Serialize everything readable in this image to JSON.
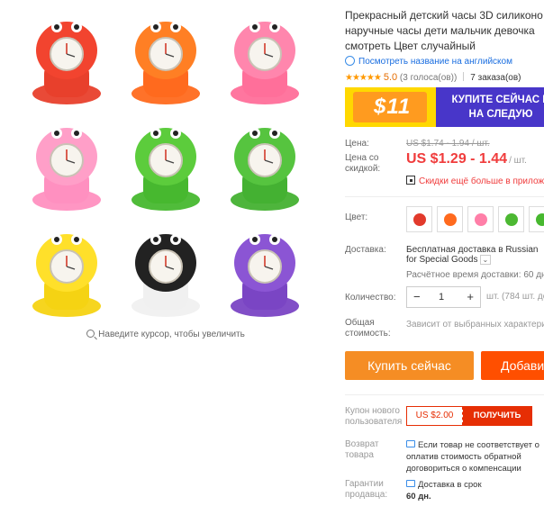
{
  "gallery": {
    "zoom_hint": "Наведите курсор, чтобы увеличить",
    "thumbnails": [
      {
        "name": "crab",
        "strap": "#e8402c",
        "face": "#f2442f"
      },
      {
        "name": "clownfish",
        "strap": "#ff6a1e",
        "face": "#ff7f24"
      },
      {
        "name": "penguin",
        "strap": "#ff6f9a",
        "face": "#ff86ad"
      },
      {
        "name": "butterfly",
        "strap": "#ff90c0",
        "face": "#ff9fc8"
      },
      {
        "name": "crocodile",
        "strap": "#47b82f",
        "face": "#5ccc3c"
      },
      {
        "name": "frog",
        "strap": "#44b132",
        "face": "#56c43f"
      },
      {
        "name": "duck",
        "strap": "#f5d313",
        "face": "#ffe02a"
      },
      {
        "name": "panda",
        "strap": "#f0f0f0",
        "face": "#222222"
      },
      {
        "name": "octopus",
        "strap": "#7a45c4",
        "face": "#8b55d4"
      }
    ]
  },
  "product": {
    "title_lines": [
      "Прекрасный детский часы 3D силиконо",
      "наручные часы дети мальчик девочка",
      "смотреть Цвет случайный"
    ],
    "translate_link": "Посмотреть название на английском",
    "stars": "★★★★★",
    "rating": "5.0",
    "votes": "(3 голоса(ов))",
    "orders": "7 заказа(ов)"
  },
  "banner": {
    "price": "$11",
    "line1": "КУПИТЕ СЕЙЧАС И",
    "line2": "НА СЛЕДУЮ"
  },
  "pricing": {
    "price_label": "Цена:",
    "old_price": "US $1.74 - 1.94 / шт.",
    "discount_label_1": "Цена со",
    "discount_label_2": "скидкой:",
    "new_price": "US $1.29 - 1.44",
    "unit": "/ шт.",
    "app_discount": "Скидки ещё больше в прилож"
  },
  "options": {
    "color_label": "Цвет:",
    "swatches": [
      "#e23a2c",
      "#ff6a1e",
      "#ff7fa8",
      "#4cb832",
      "#47b82f"
    ]
  },
  "shipping": {
    "label": "Доставка:",
    "line1": "Бесплатная доставка в Russian",
    "line2": "for Special Goods",
    "estimate": "Расчётное время доставки:  60 дн"
  },
  "quantity": {
    "label": "Количество:",
    "minus": "−",
    "value": "1",
    "plus": "+",
    "stock": "шт. (784 шт. до"
  },
  "total": {
    "label_1": "Общая",
    "label_2": "стоимость:",
    "value": "Зависит от выбранных характери"
  },
  "actions": {
    "buy_now": "Купить сейчас",
    "add_to_cart": "Добави"
  },
  "coupon": {
    "label_1": "Купон нового",
    "label_2": "пользователя",
    "amount": "US $2.00",
    "get": "ПОЛУЧИТЬ"
  },
  "returns": {
    "label_1": "Возврат",
    "label_2": "товара",
    "line1": "Если товар не соответствует о",
    "line2": "оплатив стоимость обратной",
    "line3": "договориться о компенсации"
  },
  "guarantee": {
    "label_1": "Гарантии",
    "label_2": "продавца:",
    "line1": "Доставка в срок",
    "line2": "60 дн."
  }
}
